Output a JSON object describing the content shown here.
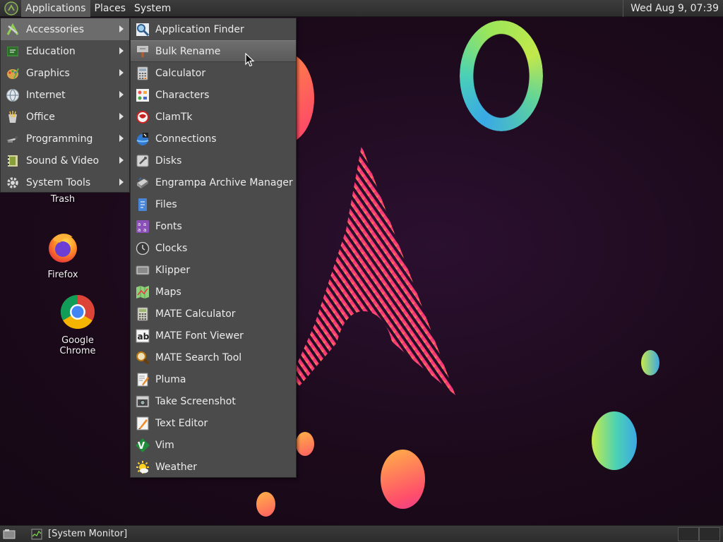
{
  "top_panel": {
    "menus": [
      "Applications",
      "Places",
      "System"
    ],
    "clock": "Wed Aug  9, 07:39"
  },
  "categories": [
    {
      "label": "Accessories",
      "icon": "accessories-icon"
    },
    {
      "label": "Education",
      "icon": "education-icon"
    },
    {
      "label": "Graphics",
      "icon": "graphics-icon"
    },
    {
      "label": "Internet",
      "icon": "internet-icon"
    },
    {
      "label": "Office",
      "icon": "office-icon"
    },
    {
      "label": "Programming",
      "icon": "programming-icon"
    },
    {
      "label": "Sound & Video",
      "icon": "sound-video-icon"
    },
    {
      "label": "System Tools",
      "icon": "system-tools-icon"
    }
  ],
  "active_category": "Accessories",
  "accessories": [
    "Application Finder",
    "Bulk Rename",
    "Calculator",
    "Characters",
    "ClamTk",
    "Connections",
    "Disks",
    "Engrampa Archive Manager",
    "Files",
    "Fonts",
    "Clocks",
    "Klipper",
    "Maps",
    "MATE Calculator",
    "MATE Font Viewer",
    "MATE Search Tool",
    "Pluma",
    "Take Screenshot",
    "Text Editor",
    "Vim",
    "Weather"
  ],
  "highlighted_item": "Bulk Rename",
  "desktop_icons": {
    "trash": "Trash",
    "firefox": "Firefox",
    "chrome": "Google Chrome"
  },
  "taskbar": {
    "window": "[System Monitor]"
  },
  "colors": {
    "panel": "#2d2d2d",
    "menu_bg": "#4b4b4b",
    "menu_highlight": "#6c6c6c",
    "wallpaper": "#1c0a1b"
  }
}
